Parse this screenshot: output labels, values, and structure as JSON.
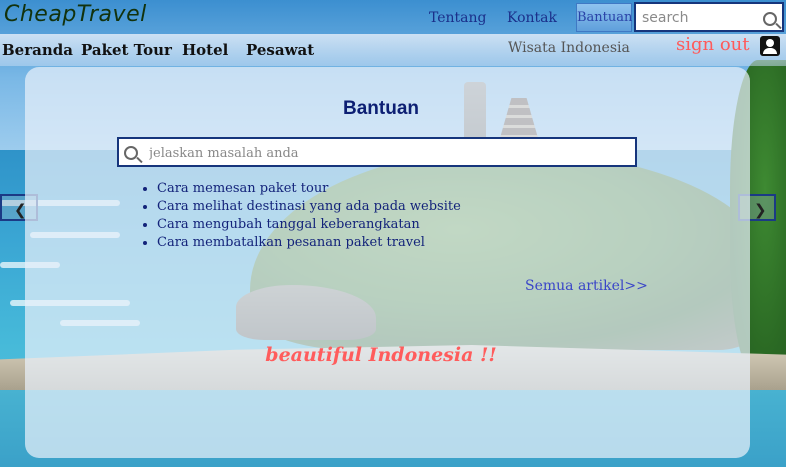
{
  "header": {
    "logo": "CheapTravel",
    "links": [
      {
        "label": "Tentang"
      },
      {
        "label": "Kontak"
      },
      {
        "label": "Bantuan",
        "active": true
      }
    ],
    "search_placeholder": "search"
  },
  "nav": {
    "items": [
      {
        "label": "Beranda"
      },
      {
        "label": "Paket Tour"
      },
      {
        "label": "Hotel"
      },
      {
        "label": "Pesawat"
      }
    ],
    "right_label": "Wisata Indonesia",
    "signout_label": "sign out",
    "user_icon": "user-icon"
  },
  "help": {
    "title": "Bantuan",
    "search_placeholder": "jelaskan masalah anda",
    "articles": [
      "Cara memesan paket tour",
      "Cara melihat destinasi yang ada pada website",
      "Cara mengubah tanggal keberangkatan",
      "Cara membatalkan pesanan paket travel"
    ],
    "all_articles_label": "Semua artikel>>"
  },
  "hero": {
    "tagline": "beautiful Indonesia !!"
  },
  "carousel": {
    "prev_icon": "chevron-left-icon",
    "next_icon": "chevron-right-icon"
  },
  "colors": {
    "accent": "#16357c",
    "signout": "#ff5a5a",
    "tagline": "#ff5c5c",
    "link": "#3a45c8"
  }
}
